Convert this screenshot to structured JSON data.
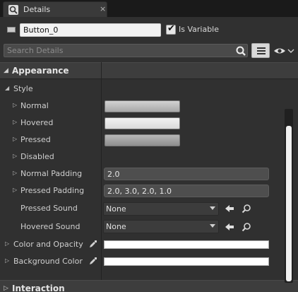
{
  "tab": {
    "title": "Details",
    "close_glyph": "×",
    "icon": "magnifier-icon"
  },
  "header": {
    "widget_name": "Button_0",
    "is_variable_label": "Is Variable",
    "is_variable_checked": true,
    "search_placeholder": "Search Details"
  },
  "categories": [
    {
      "label": "Appearance",
      "expanded": true
    },
    {
      "label": "Interaction",
      "expanded": false
    }
  ],
  "style_group": {
    "label": "Style",
    "expanded": true
  },
  "properties": {
    "normal": {
      "label": "Normal"
    },
    "hovered": {
      "label": "Hovered"
    },
    "pressed": {
      "label": "Pressed"
    },
    "disabled": {
      "label": "Disabled"
    },
    "normal_padding": {
      "label": "Normal Padding",
      "value": "2.0"
    },
    "pressed_padding": {
      "label": "Pressed Padding",
      "value": "2.0, 3.0, 2.0, 1.0"
    },
    "pressed_sound": {
      "label": "Pressed Sound",
      "value": "None"
    },
    "hovered_sound": {
      "label": "Hovered Sound",
      "value": "None"
    },
    "color_and_opacity": {
      "label": "Color and Opacity",
      "color": "#FFFFFF"
    },
    "background_color": {
      "label": "Background Color",
      "color": "#FFFFFF"
    }
  },
  "icons": {
    "expand": "▷",
    "collapse": "◢",
    "use_selected": "left-arrow-icon",
    "browse": "magnifier-icon",
    "eyedropper": "eyedropper-icon"
  }
}
